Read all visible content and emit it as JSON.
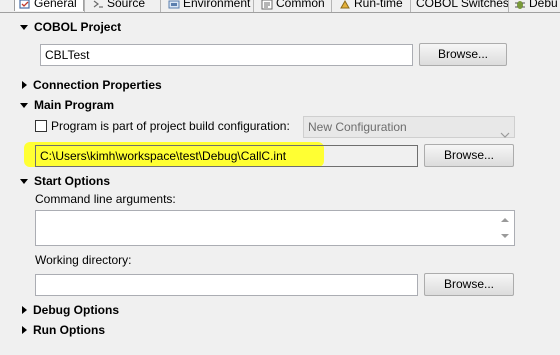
{
  "tabs": [
    {
      "label": "General",
      "icon": "general-icon",
      "active": true
    },
    {
      "label": "Source",
      "icon": "source-icon",
      "active": false
    },
    {
      "label": "Environment",
      "icon": "environment-icon",
      "active": false
    },
    {
      "label": "Common",
      "icon": "common-icon",
      "active": false
    },
    {
      "label": "Run-time",
      "icon": "runtime-icon",
      "active": false
    },
    {
      "label": "COBOL Switches",
      "icon": "",
      "active": false
    },
    {
      "label": "Debu",
      "icon": "debug-icon",
      "active": false
    }
  ],
  "cobol_project": {
    "title": "COBOL Project",
    "value": "CBLTest",
    "browse_label": "Browse..."
  },
  "connection_properties": {
    "title": "Connection Properties"
  },
  "main_program": {
    "title": "Main Program",
    "checkbox_label": "Program is part of project build configuration:",
    "checkbox_checked": false,
    "configuration_value": "New Configuration",
    "path_value": "C:\\Users\\kimh\\workspace\\test\\Debug\\CallC.int",
    "browse_label": "Browse..."
  },
  "start_options": {
    "title": "Start Options",
    "args_label": "Command line arguments:",
    "args_value": "",
    "workdir_label": "Working directory:",
    "workdir_value": "",
    "browse_label": "Browse..."
  },
  "debug_options": {
    "title": "Debug Options"
  },
  "run_options": {
    "title": "Run Options"
  },
  "colors": {
    "highlight": "#ffff33",
    "background": "#f0f0f0"
  }
}
